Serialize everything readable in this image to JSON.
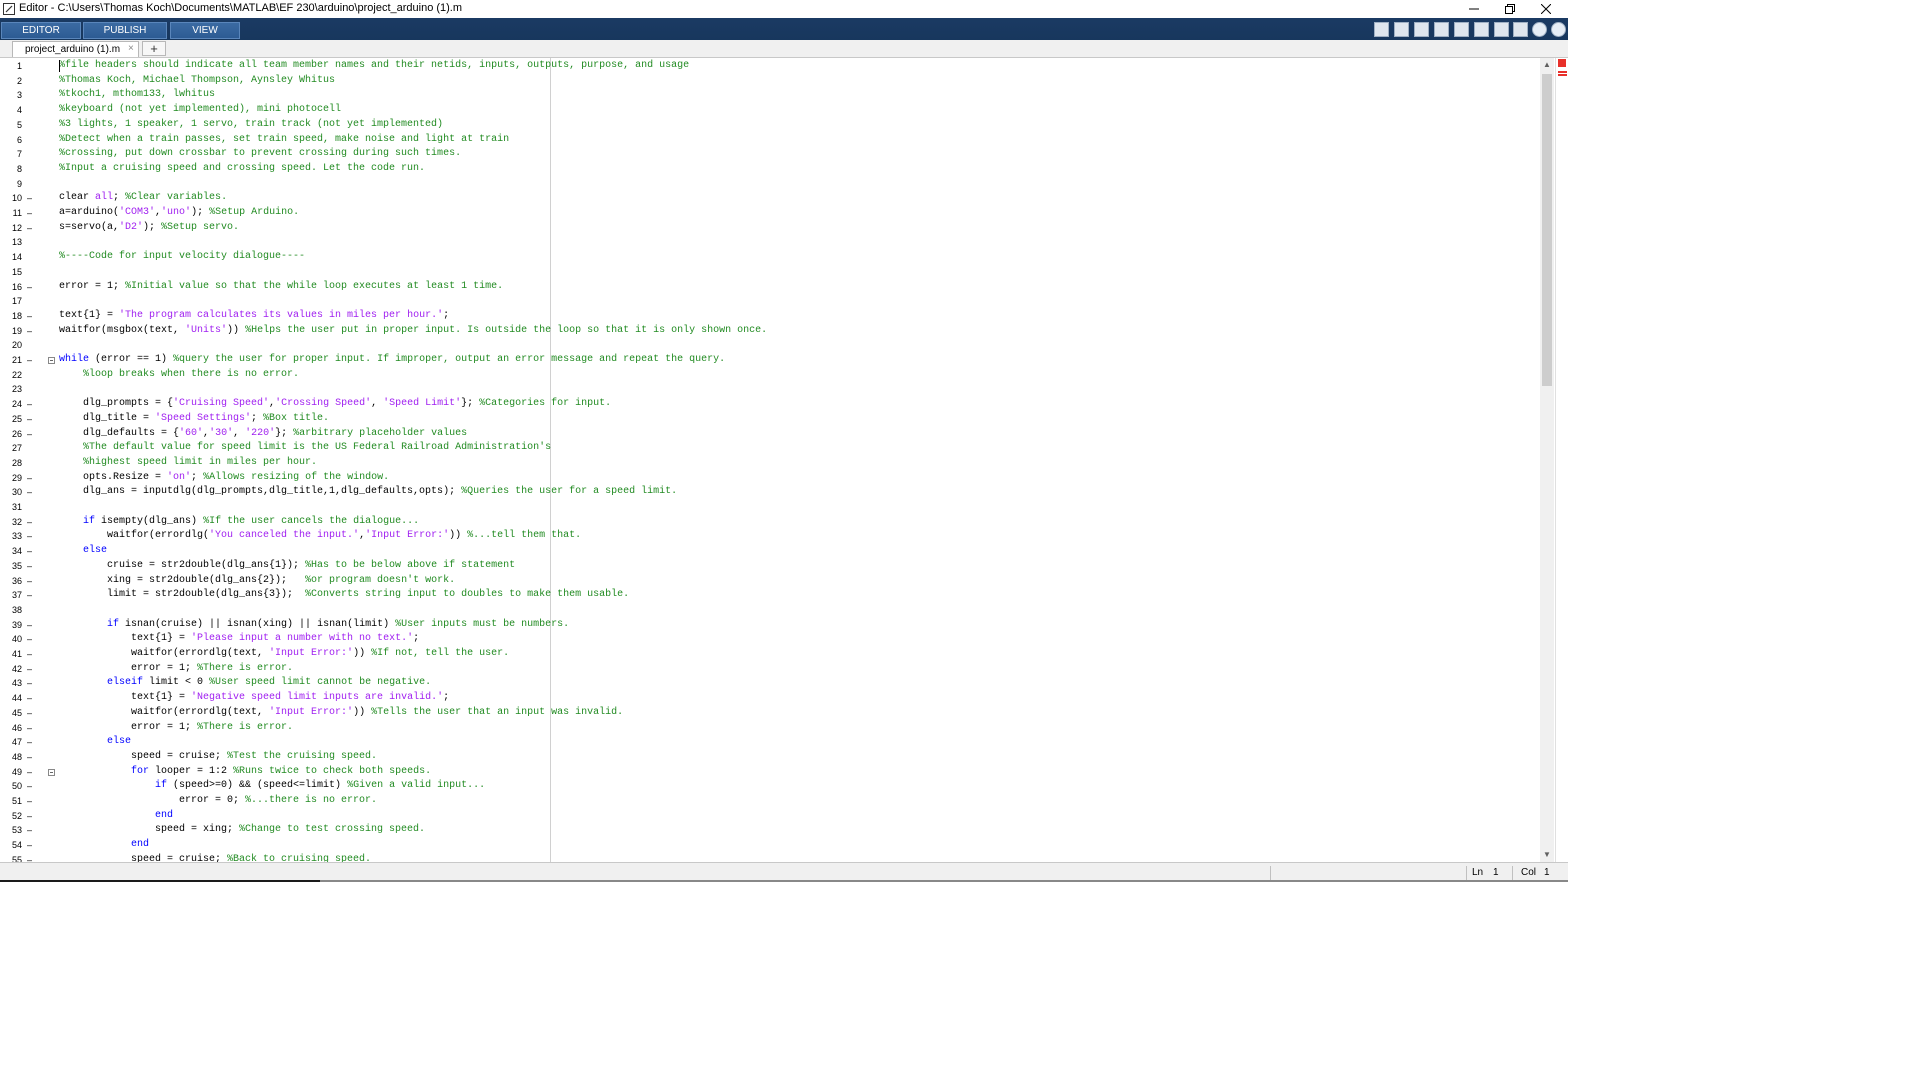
{
  "window": {
    "title": "Editor - C:\\Users\\Thomas Koch\\Documents\\MATLAB\\EF 230\\arduino\\project_arduino (1).m"
  },
  "ribbon": {
    "tabs": [
      {
        "label": "EDITOR"
      },
      {
        "label": "PUBLISH"
      },
      {
        "label": "VIEW"
      }
    ]
  },
  "quick_access": [
    "open-icon",
    "save-icon",
    "cut-icon",
    "copy-icon",
    "paste-icon",
    "undo-icon",
    "redo-icon",
    "switch-windows-icon",
    "help-icon",
    "expand-icon"
  ],
  "document_tab": {
    "label": "project_arduino (1).m",
    "close_symbol": "×",
    "new_tab_symbol": "+"
  },
  "code_lines": [
    {
      "n": "1",
      "dash": false,
      "fold": false,
      "tokens": [
        {
          "t": "%file headers should indicate all team member names and their netids, inputs, outputs, purpose, and usage",
          "c": "cmt"
        }
      ]
    },
    {
      "n": "2",
      "dash": false,
      "fold": false,
      "tokens": [
        {
          "t": "%Thomas Koch, Michael Thompson, Aynsley Whitus",
          "c": "cmt"
        }
      ]
    },
    {
      "n": "3",
      "dash": false,
      "fold": false,
      "tokens": [
        {
          "t": "%tkoch1, mthom133, lwhitus",
          "c": "cmt"
        }
      ]
    },
    {
      "n": "4",
      "dash": false,
      "fold": false,
      "tokens": [
        {
          "t": "%keyboard (not yet implemented), mini photocell",
          "c": "cmt"
        }
      ]
    },
    {
      "n": "5",
      "dash": false,
      "fold": false,
      "tokens": [
        {
          "t": "%3 lights, 1 speaker, 1 servo, train track (not yet implemented)",
          "c": "cmt"
        }
      ]
    },
    {
      "n": "6",
      "dash": false,
      "fold": false,
      "tokens": [
        {
          "t": "%Detect when a train passes, set train speed, make noise and light at train",
          "c": "cmt"
        }
      ]
    },
    {
      "n": "7",
      "dash": false,
      "fold": false,
      "tokens": [
        {
          "t": "%crossing, put down crossbar to prevent crossing during such times.",
          "c": "cmt"
        }
      ]
    },
    {
      "n": "8",
      "dash": false,
      "fold": false,
      "tokens": [
        {
          "t": "%Input a cruising speed and crossing speed. Let the code run.",
          "c": "cmt"
        }
      ]
    },
    {
      "n": "9",
      "dash": false,
      "fold": false,
      "tokens": []
    },
    {
      "n": "10",
      "dash": true,
      "fold": false,
      "tokens": [
        {
          "t": "clear ",
          "c": ""
        },
        {
          "t": "all",
          "c": "str"
        },
        {
          "t": "; ",
          "c": ""
        },
        {
          "t": "%Clear variables.",
          "c": "cmt"
        }
      ]
    },
    {
      "n": "11",
      "dash": true,
      "fold": false,
      "tokens": [
        {
          "t": "a=arduino(",
          "c": ""
        },
        {
          "t": "'COM3'",
          "c": "str"
        },
        {
          "t": ",",
          "c": ""
        },
        {
          "t": "'uno'",
          "c": "str"
        },
        {
          "t": "); ",
          "c": ""
        },
        {
          "t": "%Setup Arduino.",
          "c": "cmt"
        }
      ]
    },
    {
      "n": "12",
      "dash": true,
      "fold": false,
      "tokens": [
        {
          "t": "s=servo(a,",
          "c": ""
        },
        {
          "t": "'D2'",
          "c": "str"
        },
        {
          "t": "); ",
          "c": ""
        },
        {
          "t": "%Setup servo.",
          "c": "cmt"
        }
      ]
    },
    {
      "n": "13",
      "dash": false,
      "fold": false,
      "tokens": []
    },
    {
      "n": "14",
      "dash": false,
      "fold": false,
      "tokens": [
        {
          "t": "%----Code for input velocity dialogue----",
          "c": "cmt"
        }
      ]
    },
    {
      "n": "15",
      "dash": false,
      "fold": false,
      "tokens": []
    },
    {
      "n": "16",
      "dash": true,
      "fold": false,
      "tokens": [
        {
          "t": "error = 1; ",
          "c": ""
        },
        {
          "t": "%Initial value so that the while loop executes at least 1 time.",
          "c": "cmt"
        }
      ]
    },
    {
      "n": "17",
      "dash": false,
      "fold": false,
      "tokens": []
    },
    {
      "n": "18",
      "dash": true,
      "fold": false,
      "tokens": [
        {
          "t": "text{1} = ",
          "c": ""
        },
        {
          "t": "'The program calculates its values in miles per hour.'",
          "c": "str"
        },
        {
          "t": ";",
          "c": ""
        }
      ]
    },
    {
      "n": "19",
      "dash": true,
      "fold": false,
      "tokens": [
        {
          "t": "waitfor(msgbox(text, ",
          "c": ""
        },
        {
          "t": "'Units'",
          "c": "str"
        },
        {
          "t": ")) ",
          "c": ""
        },
        {
          "t": "%Helps the user put in proper input. Is outside the loop so that it is only shown once.",
          "c": "cmt"
        }
      ]
    },
    {
      "n": "20",
      "dash": false,
      "fold": false,
      "tokens": []
    },
    {
      "n": "21",
      "dash": true,
      "fold": true,
      "tokens": [
        {
          "t": "while",
          "c": "kw"
        },
        {
          "t": " (error == 1) ",
          "c": ""
        },
        {
          "t": "%query the user for proper input. If improper, output an error message and repeat the query.",
          "c": "cmt"
        }
      ]
    },
    {
      "n": "22",
      "dash": false,
      "fold": false,
      "tokens": [
        {
          "t": "    ",
          "c": ""
        },
        {
          "t": "%loop breaks when there is no error.",
          "c": "cmt"
        }
      ]
    },
    {
      "n": "23",
      "dash": false,
      "fold": false,
      "tokens": []
    },
    {
      "n": "24",
      "dash": true,
      "fold": false,
      "tokens": [
        {
          "t": "    dlg_prompts = {",
          "c": ""
        },
        {
          "t": "'Cruising Speed'",
          "c": "str"
        },
        {
          "t": ",",
          "c": ""
        },
        {
          "t": "'Crossing Speed'",
          "c": "str"
        },
        {
          "t": ", ",
          "c": ""
        },
        {
          "t": "'Speed Limit'",
          "c": "str"
        },
        {
          "t": "}; ",
          "c": ""
        },
        {
          "t": "%Categories for input.",
          "c": "cmt"
        }
      ]
    },
    {
      "n": "25",
      "dash": true,
      "fold": false,
      "tokens": [
        {
          "t": "    dlg_title = ",
          "c": ""
        },
        {
          "t": "'Speed Settings'",
          "c": "str"
        },
        {
          "t": "; ",
          "c": ""
        },
        {
          "t": "%Box title.",
          "c": "cmt"
        }
      ]
    },
    {
      "n": "26",
      "dash": true,
      "fold": false,
      "tokens": [
        {
          "t": "    dlg_defaults = {",
          "c": ""
        },
        {
          "t": "'60'",
          "c": "str"
        },
        {
          "t": ",",
          "c": ""
        },
        {
          "t": "'30'",
          "c": "str"
        },
        {
          "t": ", ",
          "c": ""
        },
        {
          "t": "'220'",
          "c": "str"
        },
        {
          "t": "}; ",
          "c": ""
        },
        {
          "t": "%arbitrary placeholder values",
          "c": "cmt"
        }
      ]
    },
    {
      "n": "27",
      "dash": false,
      "fold": false,
      "tokens": [
        {
          "t": "    ",
          "c": ""
        },
        {
          "t": "%The default value for speed limit is the US Federal Railroad Administration's",
          "c": "cmt"
        }
      ]
    },
    {
      "n": "28",
      "dash": false,
      "fold": false,
      "tokens": [
        {
          "t": "    ",
          "c": ""
        },
        {
          "t": "%highest speed limit in miles per hour.",
          "c": "cmt"
        }
      ]
    },
    {
      "n": "29",
      "dash": true,
      "fold": false,
      "tokens": [
        {
          "t": "    opts.Resize = ",
          "c": ""
        },
        {
          "t": "'on'",
          "c": "str"
        },
        {
          "t": "; ",
          "c": ""
        },
        {
          "t": "%Allows resizing of the window.",
          "c": "cmt"
        }
      ]
    },
    {
      "n": "30",
      "dash": true,
      "fold": false,
      "tokens": [
        {
          "t": "    dlg_ans = inputdlg(dlg_prompts,dlg_title,1,dlg_defaults,opts); ",
          "c": ""
        },
        {
          "t": "%Queries the user for a speed limit.",
          "c": "cmt"
        }
      ]
    },
    {
      "n": "31",
      "dash": false,
      "fold": false,
      "tokens": []
    },
    {
      "n": "32",
      "dash": true,
      "fold": false,
      "tokens": [
        {
          "t": "    ",
          "c": ""
        },
        {
          "t": "if",
          "c": "kw"
        },
        {
          "t": " isempty(dlg_ans) ",
          "c": ""
        },
        {
          "t": "%If the user cancels the dialogue...",
          "c": "cmt"
        }
      ]
    },
    {
      "n": "33",
      "dash": true,
      "fold": false,
      "tokens": [
        {
          "t": "        waitfor(errordlg(",
          "c": ""
        },
        {
          "t": "'You canceled the input.'",
          "c": "str"
        },
        {
          "t": ",",
          "c": ""
        },
        {
          "t": "'Input Error:'",
          "c": "str"
        },
        {
          "t": ")) ",
          "c": ""
        },
        {
          "t": "%...tell them that.",
          "c": "cmt"
        }
      ]
    },
    {
      "n": "34",
      "dash": true,
      "fold": false,
      "tokens": [
        {
          "t": "    ",
          "c": ""
        },
        {
          "t": "else",
          "c": "kw"
        }
      ]
    },
    {
      "n": "35",
      "dash": true,
      "fold": false,
      "tokens": [
        {
          "t": "        cruise = str2double(dlg_ans{1}); ",
          "c": ""
        },
        {
          "t": "%Has to be below above if statement",
          "c": "cmt"
        }
      ]
    },
    {
      "n": "36",
      "dash": true,
      "fold": false,
      "tokens": [
        {
          "t": "        xing = str2double(dlg_ans{2});   ",
          "c": ""
        },
        {
          "t": "%or program doesn't work.",
          "c": "cmt"
        }
      ]
    },
    {
      "n": "37",
      "dash": true,
      "fold": false,
      "tokens": [
        {
          "t": "        limit = str2double(dlg_ans{3});  ",
          "c": ""
        },
        {
          "t": "%Converts string input to doubles to make them usable.",
          "c": "cmt"
        }
      ]
    },
    {
      "n": "38",
      "dash": false,
      "fold": false,
      "tokens": []
    },
    {
      "n": "39",
      "dash": true,
      "fold": false,
      "tokens": [
        {
          "t": "        ",
          "c": ""
        },
        {
          "t": "if",
          "c": "kw"
        },
        {
          "t": " isnan(cruise) || isnan(xing) || isnan(limit) ",
          "c": ""
        },
        {
          "t": "%User inputs must be numbers.",
          "c": "cmt"
        }
      ]
    },
    {
      "n": "40",
      "dash": true,
      "fold": false,
      "tokens": [
        {
          "t": "            text{1} = ",
          "c": ""
        },
        {
          "t": "'Please input a number with no text.'",
          "c": "str"
        },
        {
          "t": ";",
          "c": ""
        }
      ]
    },
    {
      "n": "41",
      "dash": true,
      "fold": false,
      "tokens": [
        {
          "t": "            waitfor(errordlg(text, ",
          "c": ""
        },
        {
          "t": "'Input Error:'",
          "c": "str"
        },
        {
          "t": ")) ",
          "c": ""
        },
        {
          "t": "%If not, tell the user.",
          "c": "cmt"
        }
      ]
    },
    {
      "n": "42",
      "dash": true,
      "fold": false,
      "tokens": [
        {
          "t": "            error = 1; ",
          "c": ""
        },
        {
          "t": "%There is error.",
          "c": "cmt"
        }
      ]
    },
    {
      "n": "43",
      "dash": true,
      "fold": false,
      "tokens": [
        {
          "t": "        ",
          "c": ""
        },
        {
          "t": "elseif",
          "c": "kw"
        },
        {
          "t": " limit < 0 ",
          "c": ""
        },
        {
          "t": "%User speed limit cannot be negative.",
          "c": "cmt"
        }
      ]
    },
    {
      "n": "44",
      "dash": true,
      "fold": false,
      "tokens": [
        {
          "t": "            text{1} = ",
          "c": ""
        },
        {
          "t": "'Negative speed limit inputs are invalid.'",
          "c": "str"
        },
        {
          "t": ";",
          "c": ""
        }
      ]
    },
    {
      "n": "45",
      "dash": true,
      "fold": false,
      "tokens": [
        {
          "t": "            waitfor(errordlg(text, ",
          "c": ""
        },
        {
          "t": "'Input Error:'",
          "c": "str"
        },
        {
          "t": ")) ",
          "c": ""
        },
        {
          "t": "%Tells the user that an input was invalid.",
          "c": "cmt"
        }
      ]
    },
    {
      "n": "46",
      "dash": true,
      "fold": false,
      "tokens": [
        {
          "t": "            error = 1; ",
          "c": ""
        },
        {
          "t": "%There is error.",
          "c": "cmt"
        }
      ]
    },
    {
      "n": "47",
      "dash": true,
      "fold": false,
      "tokens": [
        {
          "t": "        ",
          "c": ""
        },
        {
          "t": "else",
          "c": "kw"
        }
      ]
    },
    {
      "n": "48",
      "dash": true,
      "fold": false,
      "tokens": [
        {
          "t": "            speed = cruise; ",
          "c": ""
        },
        {
          "t": "%Test the cruising speed.",
          "c": "cmt"
        }
      ]
    },
    {
      "n": "49",
      "dash": true,
      "fold": true,
      "tokens": [
        {
          "t": "            ",
          "c": ""
        },
        {
          "t": "for",
          "c": "kw"
        },
        {
          "t": " looper = 1:2 ",
          "c": ""
        },
        {
          "t": "%Runs twice to check both speeds.",
          "c": "cmt"
        }
      ]
    },
    {
      "n": "50",
      "dash": true,
      "fold": false,
      "tokens": [
        {
          "t": "                ",
          "c": ""
        },
        {
          "t": "if",
          "c": "kw"
        },
        {
          "t": " (speed>=0) && (speed<=limit) ",
          "c": ""
        },
        {
          "t": "%Given a valid input...",
          "c": "cmt"
        }
      ]
    },
    {
      "n": "51",
      "dash": true,
      "fold": false,
      "tokens": [
        {
          "t": "                    error = 0; ",
          "c": ""
        },
        {
          "t": "%...there is no error.",
          "c": "cmt"
        }
      ]
    },
    {
      "n": "52",
      "dash": true,
      "fold": false,
      "tokens": [
        {
          "t": "                ",
          "c": ""
        },
        {
          "t": "end",
          "c": "kw"
        }
      ]
    },
    {
      "n": "53",
      "dash": true,
      "fold": false,
      "tokens": [
        {
          "t": "                speed = xing; ",
          "c": ""
        },
        {
          "t": "%Change to test crossing speed.",
          "c": "cmt"
        }
      ]
    },
    {
      "n": "54",
      "dash": true,
      "fold": false,
      "tokens": [
        {
          "t": "            ",
          "c": ""
        },
        {
          "t": "end",
          "c": "kw"
        }
      ]
    },
    {
      "n": "55",
      "dash": true,
      "fold": false,
      "tokens": [
        {
          "t": "            speed = cruise; ",
          "c": ""
        },
        {
          "t": "%Back to cruising speed.",
          "c": "cmt"
        }
      ]
    }
  ],
  "status": {
    "ln_label": "Ln",
    "ln_value": "1",
    "col_label": "Col",
    "col_value": "1"
  }
}
